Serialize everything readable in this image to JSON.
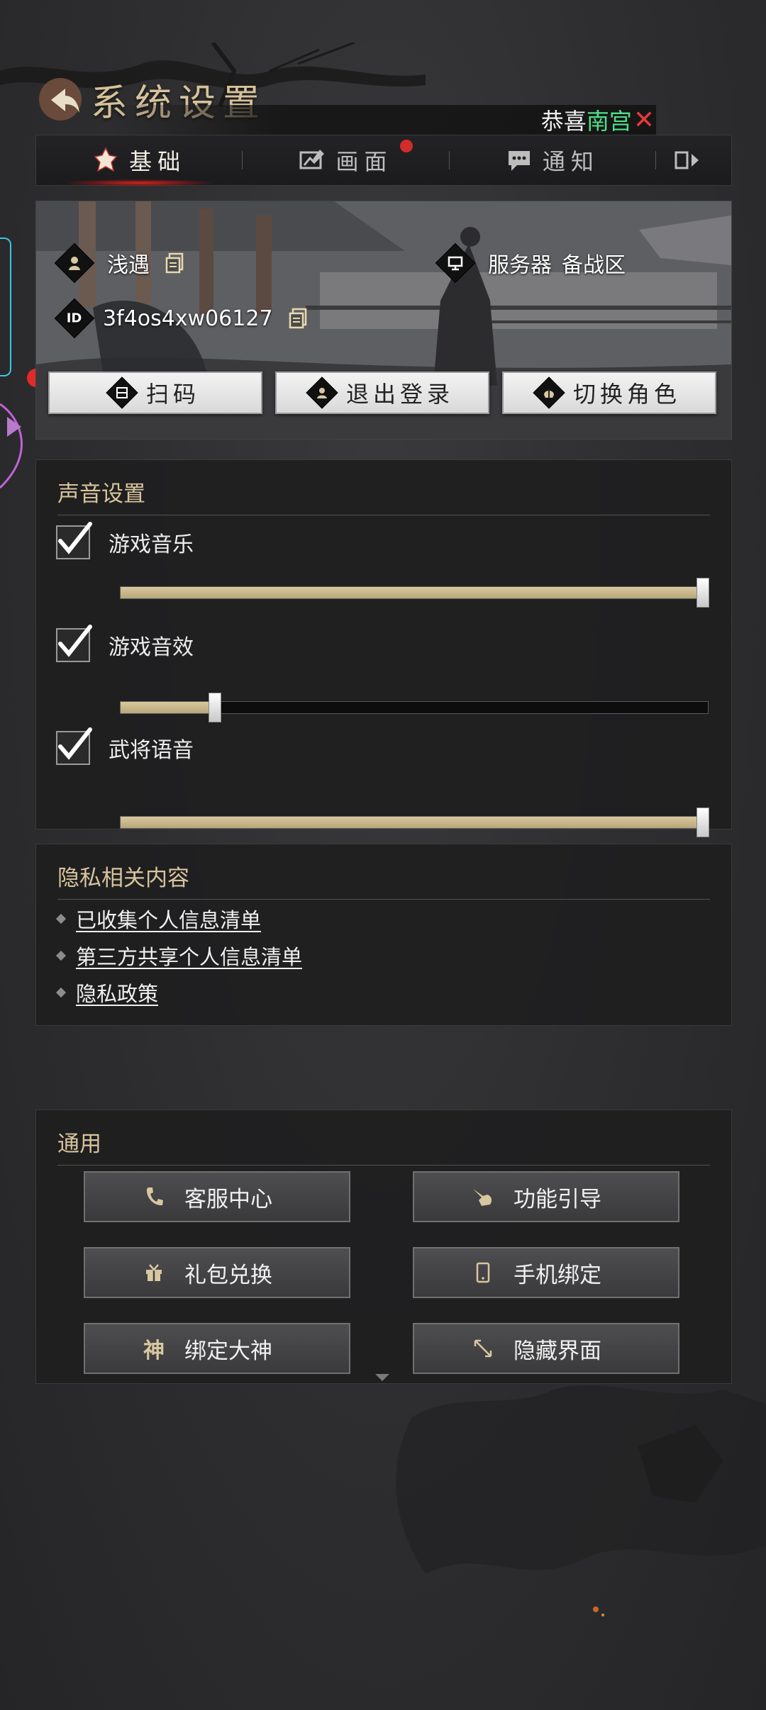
{
  "header": {
    "title": "系统设置"
  },
  "banner": {
    "prefix": "恭喜",
    "name": "南宫",
    "close": "✕"
  },
  "tabs": [
    {
      "label": "基础",
      "active": true
    },
    {
      "label": "画面",
      "badge": true
    },
    {
      "label": "通知"
    },
    {
      "label": ""
    }
  ],
  "account": {
    "name": "浅遇",
    "id_label": "ID",
    "id": "3f4os4xw06127",
    "server_label": "服务器",
    "server": "备战区",
    "buttons": {
      "scan": "扫码",
      "logout": "退出登录",
      "switch_role": "切换角色"
    }
  },
  "sound": {
    "title": "声音设置",
    "items": [
      {
        "label": "游戏音乐",
        "checked": true,
        "level": 1.0
      },
      {
        "label": "游戏音效",
        "checked": true,
        "level": 0.16
      },
      {
        "label": "武将语音",
        "checked": true,
        "level": 1.0
      }
    ]
  },
  "privacy": {
    "title": "隐私相关内容",
    "links": [
      "已收集个人信息清单",
      "第三方共享个人信息清单",
      "隐私政策"
    ]
  },
  "general": {
    "title": "通用",
    "buttons": [
      {
        "label": "客服中心",
        "icon": "phone-icon"
      },
      {
        "label": "功能引导",
        "icon": "hand-pointer-icon"
      },
      {
        "label": "礼包兑换",
        "icon": "gift-icon"
      },
      {
        "label": "手机绑定",
        "icon": "mobile-icon"
      },
      {
        "label": "绑定大神",
        "icon": "shen-icon",
        "icon_text": "神"
      },
      {
        "label": "隐藏界面",
        "icon": "resize-arrows-icon"
      }
    ]
  }
}
